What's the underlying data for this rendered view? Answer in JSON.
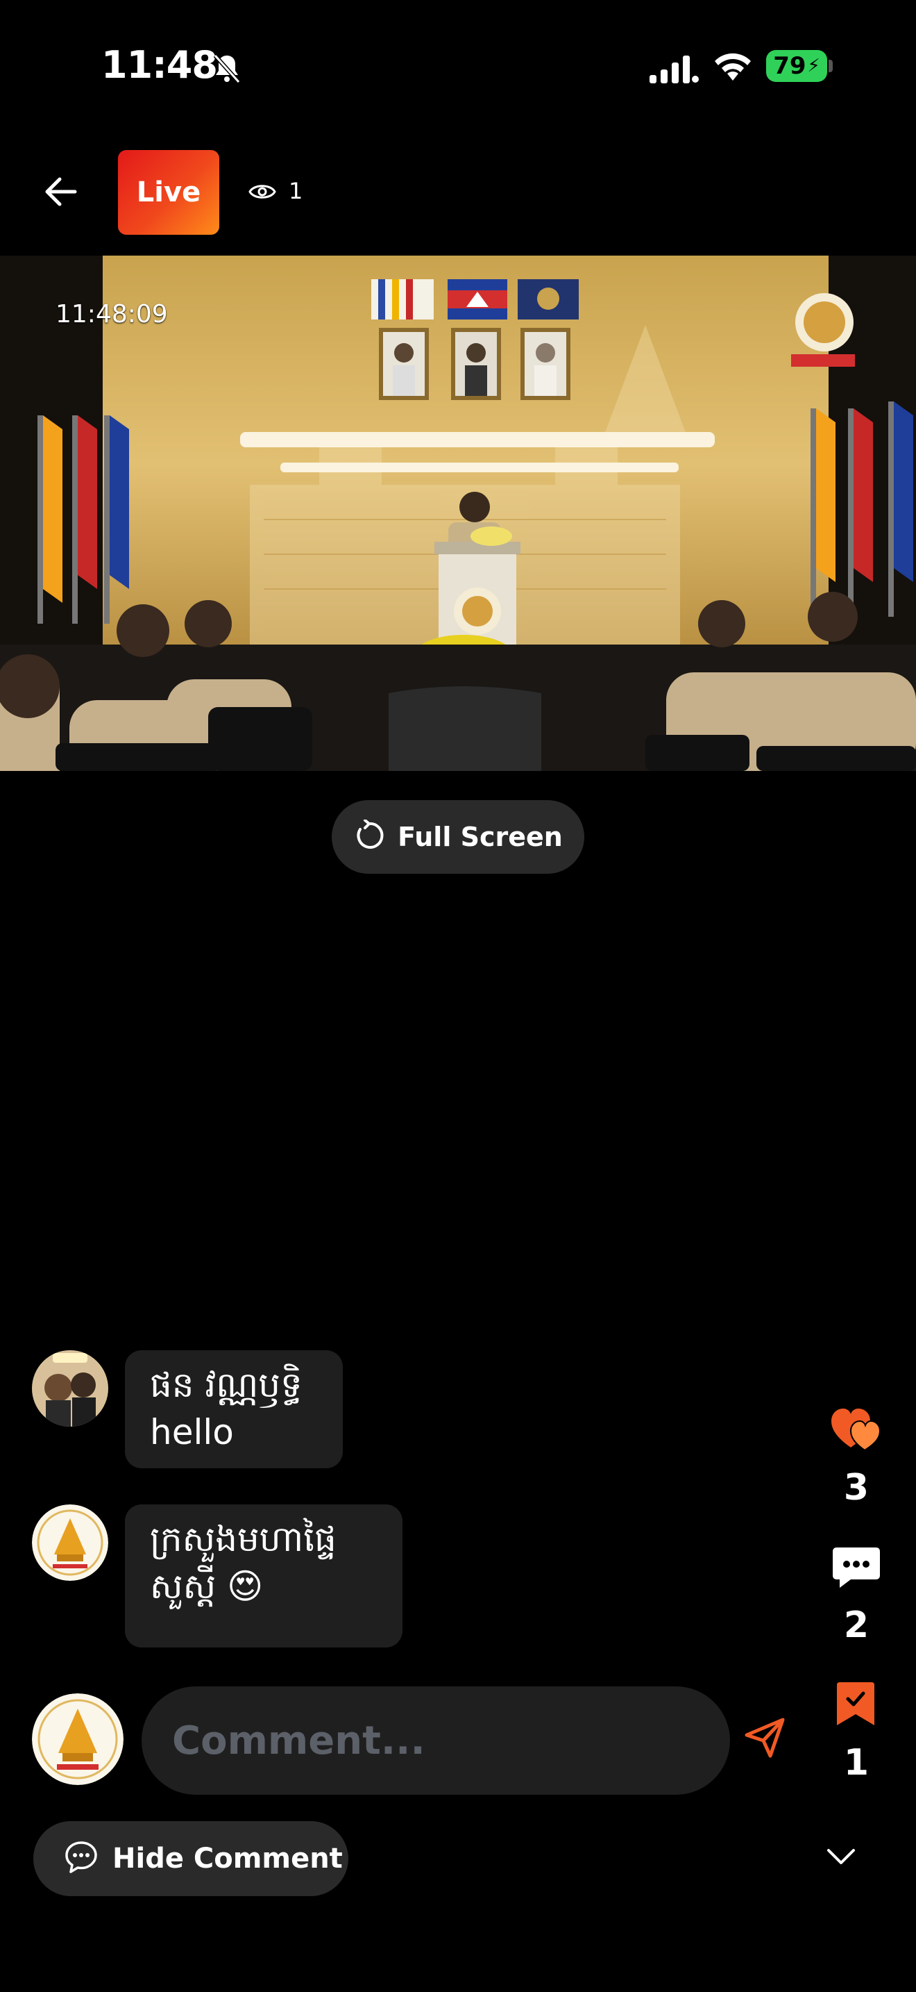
{
  "status_bar": {
    "time": "11:48",
    "battery": "79"
  },
  "header": {
    "live_label": "Live",
    "viewer_count": "1"
  },
  "video": {
    "timestamp": "11:48:09"
  },
  "fullscreen": {
    "label": "Full Screen"
  },
  "comments": [
    {
      "author": "ផន វណ្ណឫទ្ធិ",
      "text": "hello"
    },
    {
      "author": "ក្រសួងមហាផ្ទៃ",
      "text": "សួស្តី 😍"
    }
  ],
  "comment_input": {
    "placeholder": "Comment..."
  },
  "stats": {
    "likes": "3",
    "comments": "2",
    "saves": "1"
  },
  "bottom": {
    "hide_comment_label": "Hide Comment"
  },
  "colors": {
    "live_gradient_start": "#e31a1a",
    "live_gradient_end": "#ff8c1a",
    "accent": "#f15a24",
    "battery": "#2fd158"
  },
  "icons": [
    "bell-slash-icon",
    "signal-icon",
    "wifi-icon",
    "back-arrow-icon",
    "eye-icon",
    "refresh-icon",
    "send-icon",
    "heart-icon",
    "chat-icon",
    "bookmark-icon",
    "chat-bubble-icon",
    "chevron-down-icon"
  ]
}
